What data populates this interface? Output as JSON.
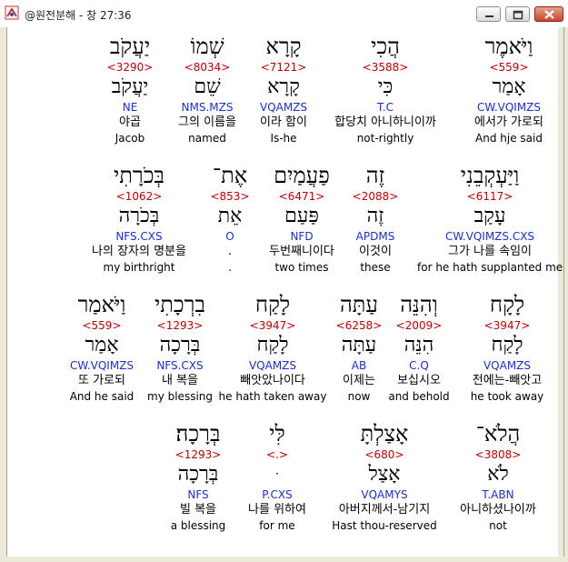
{
  "window": {
    "title": "@원전분해 - 창 27:36",
    "icons": [
      "app-icon",
      "minimize-icon",
      "maximize-icon",
      "close-icon"
    ]
  },
  "rows": [
    [
      {
        "heb": "יַעֲקֹב",
        "num": "<3290>",
        "lemma": "יַעֲקֹב",
        "code": "NE",
        "kor": "야곱",
        "eng": "Jacob"
      },
      {
        "heb": "שְׁמוֹ",
        "num": "<8034>",
        "lemma": "שֵׁם",
        "code": "NMS.MZS",
        "kor": "그의 이름을",
        "eng": "named"
      },
      {
        "heb": "קָרָא",
        "num": "<7121>",
        "lemma": "קָרָא",
        "code": "VQAMZS",
        "kor": "이라 함이",
        "eng": "Is-he"
      },
      {
        "heb": "הֲכִי",
        "num": "<3588>",
        "lemma": "כִּי",
        "code": "T.C",
        "kor": "합당치 아니하니이까",
        "eng": "not-rightly"
      },
      {
        "heb": "וַיֹּאמֶר",
        "num": "<559>",
        "lemma": "אָמַר",
        "code": "CW.VQIMZS",
        "kor": "에서가 가로되",
        "eng": "And hje said"
      }
    ],
    [
      {
        "heb": "בְּכֹרָתִי",
        "num": "<1062>",
        "lemma": "בְּכֹרָה",
        "code": "NFS.CXS",
        "kor": "나의 장자의 명분을",
        "eng": "my birthright"
      },
      {
        "heb": "אֶת־",
        "num": "<853>",
        "lemma": "אֵת",
        "code": "O",
        "kor": ".",
        "eng": "."
      },
      {
        "heb": "פַעֲמַיִם",
        "num": "<6471>",
        "lemma": "פַּעַם",
        "code": "NFD",
        "kor": "두번째니이다",
        "eng": "two times"
      },
      {
        "heb": "זֶה",
        "num": "<2088>",
        "lemma": "זֶה",
        "code": "APDMS",
        "kor": "이것이",
        "eng": "these"
      },
      {
        "heb": "וַיַּעְקְבֵנִי",
        "num": "<6117>",
        "lemma": "עָקַב",
        "code": "CW.VQIMZS.CXS",
        "kor": "그가 나를 속임이",
        "eng": "for he hath supplanted me"
      }
    ],
    [
      {
        "heb": "וַיֹּאמַר",
        "num": "<559>",
        "lemma": "אָמַר",
        "code": "CW.VQIMZS",
        "kor": "또 가로되",
        "eng": "And he said"
      },
      {
        "heb": "בִרְכָתִי",
        "num": "<1293>",
        "lemma": "בְּרָכָה",
        "code": "NFS.CXS",
        "kor": "내 복을",
        "eng": "my blessing"
      },
      {
        "heb": "לָקַח",
        "num": "<3947>",
        "lemma": "לָקַח",
        "code": "VQAMZS",
        "kor": "빼앗았나이다",
        "eng": "he hath taken away"
      },
      {
        "heb": "עַתָּה",
        "num": "<6258>",
        "lemma": "עַתָּה",
        "code": "AB",
        "kor": "이제는",
        "eng": "now"
      },
      {
        "heb": "וְהִנֵּה",
        "num": "<2009>",
        "lemma": "הִנֵּה",
        "code": "C.Q",
        "kor": "보십시오",
        "eng": "and behold"
      },
      {
        "heb": "לָקָח",
        "num": "<3947>",
        "lemma": "לָקַח",
        "code": "VQAMZS",
        "kor": "전에는-빼앗고",
        "eng": "he took away"
      }
    ],
    [
      {
        "heb": "בְּרָכָה׃",
        "num": "<1293>",
        "lemma": "בְּרָכָה",
        "code": "NFS",
        "kor": "빌 복을",
        "eng": "a blessing"
      },
      {
        "heb": "לִּי",
        "num": "<.>",
        "lemma": "ּ",
        "code": "P.CXS",
        "kor": "나를 위하여",
        "eng": "for me"
      },
      {
        "heb": "אָצַלְתָּ",
        "num": "<680>",
        "lemma": "אָצַל",
        "code": "VQAMYS",
        "kor": "아버지께서-남기지",
        "eng": "Hast thou-reserved"
      },
      {
        "heb": "הֲלֹא־",
        "num": "<3808>",
        "lemma": "לֹא",
        "code": "T.ABN",
        "kor": "아니하셨나이까",
        "eng": "not"
      }
    ]
  ]
}
